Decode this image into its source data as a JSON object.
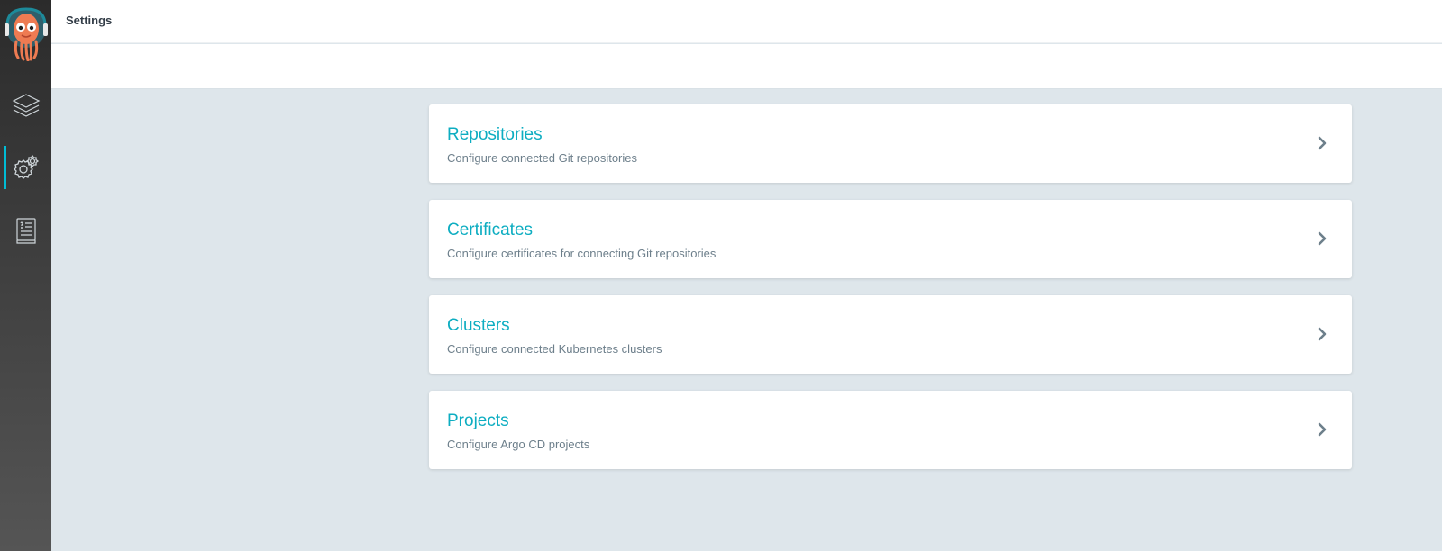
{
  "header": {
    "title": "Settings"
  },
  "sidebar": {
    "logo_icon": "argo-octopus-logo",
    "items": [
      {
        "name": "applications",
        "icon": "layers-icon",
        "active": false
      },
      {
        "name": "settings",
        "icon": "gear-icon",
        "active": true
      },
      {
        "name": "docs",
        "icon": "book-icon",
        "active": false
      }
    ]
  },
  "cards": [
    {
      "title": "Repositories",
      "description": "Configure connected Git repositories"
    },
    {
      "title": "Certificates",
      "description": "Configure certificates for connecting Git repositories"
    },
    {
      "title": "Clusters",
      "description": "Configure connected Kubernetes clusters"
    },
    {
      "title": "Projects",
      "description": "Configure Argo CD projects"
    }
  ],
  "colors": {
    "accent": "#0dadc1",
    "active_indicator": "#00bcd4",
    "background": "#dee6eb",
    "card_desc": "#6d7f8b"
  }
}
